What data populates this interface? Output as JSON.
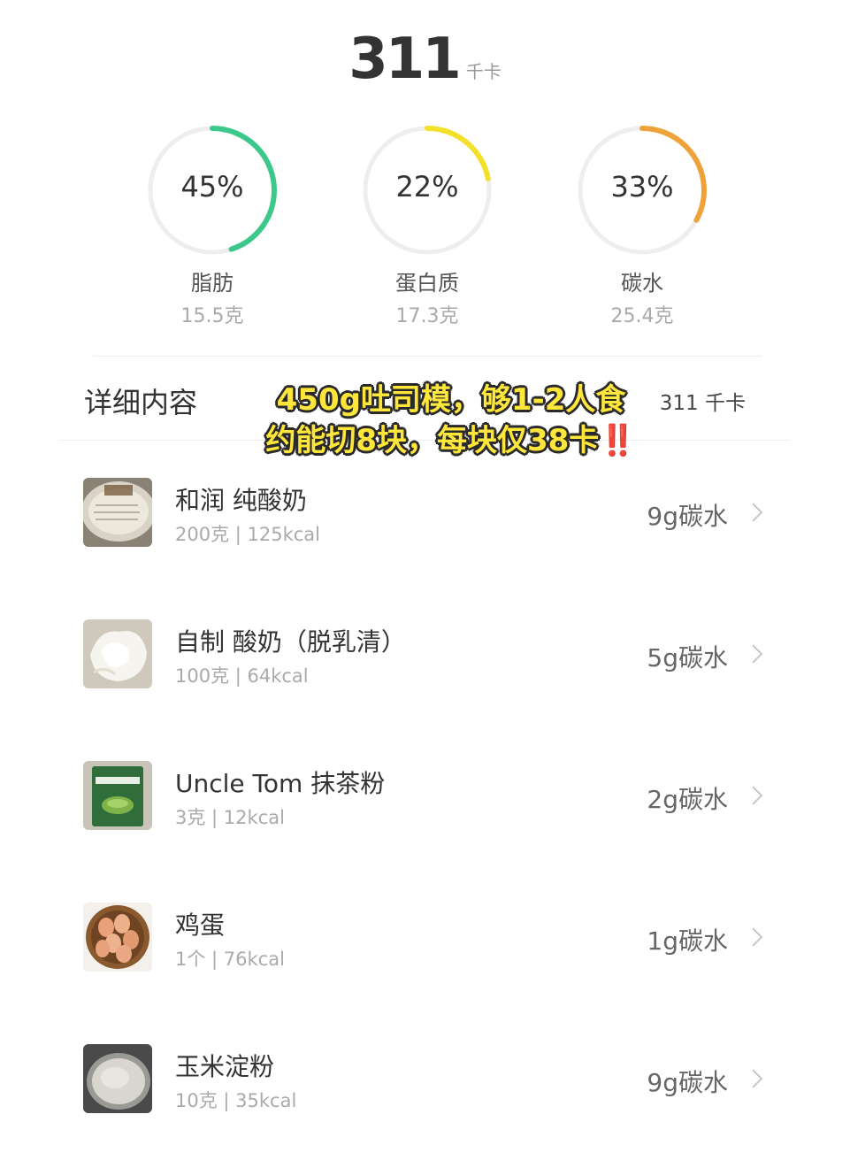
{
  "summary": {
    "total": "311",
    "unit": "千卡"
  },
  "macros": [
    {
      "percent": "45%",
      "fraction": 0.45,
      "name": "脂肪",
      "amount": "15.5克",
      "color": "#3cc88a"
    },
    {
      "percent": "22%",
      "fraction": 0.22,
      "name": "蛋白质",
      "amount": "17.3克",
      "color": "#f2e02a"
    },
    {
      "percent": "33%",
      "fraction": 0.33,
      "name": "碳水",
      "amount": "25.4克",
      "color": "#f0a23a"
    }
  ],
  "details": {
    "title": "详细内容",
    "kcal": "311 千卡"
  },
  "overlay": {
    "line1": "450g吐司模，够1-2人食",
    "line2": "约能切8块，每块仅38卡",
    "line2_mark": "‼️"
  },
  "items": [
    {
      "name": "和润 纯酸奶",
      "sub": "200克 | 125kcal",
      "carb": "9g碳水",
      "icon": "yogurt-cup-icon"
    },
    {
      "name": "自制 酸奶（脱乳清）",
      "sub": "100克 | 64kcal",
      "carb": "5g碳水",
      "icon": "strained-yogurt-icon"
    },
    {
      "name": "Uncle  Tom 抹茶粉",
      "sub": "3克 | 12kcal",
      "carb": "2g碳水",
      "icon": "matcha-powder-icon"
    },
    {
      "name": "鸡蛋",
      "sub": "1个 | 76kcal",
      "carb": "1g碳水",
      "icon": "eggs-basket-icon"
    },
    {
      "name": "玉米淀粉",
      "sub": "10克 | 35kcal",
      "carb": "9g碳水",
      "icon": "corn-starch-icon"
    }
  ],
  "colors": {
    "track": "#eeeeee",
    "fat": "#3cc88a",
    "protein": "#f2e02a",
    "carb": "#f0a23a",
    "overlay_text": "#ffe63a"
  }
}
